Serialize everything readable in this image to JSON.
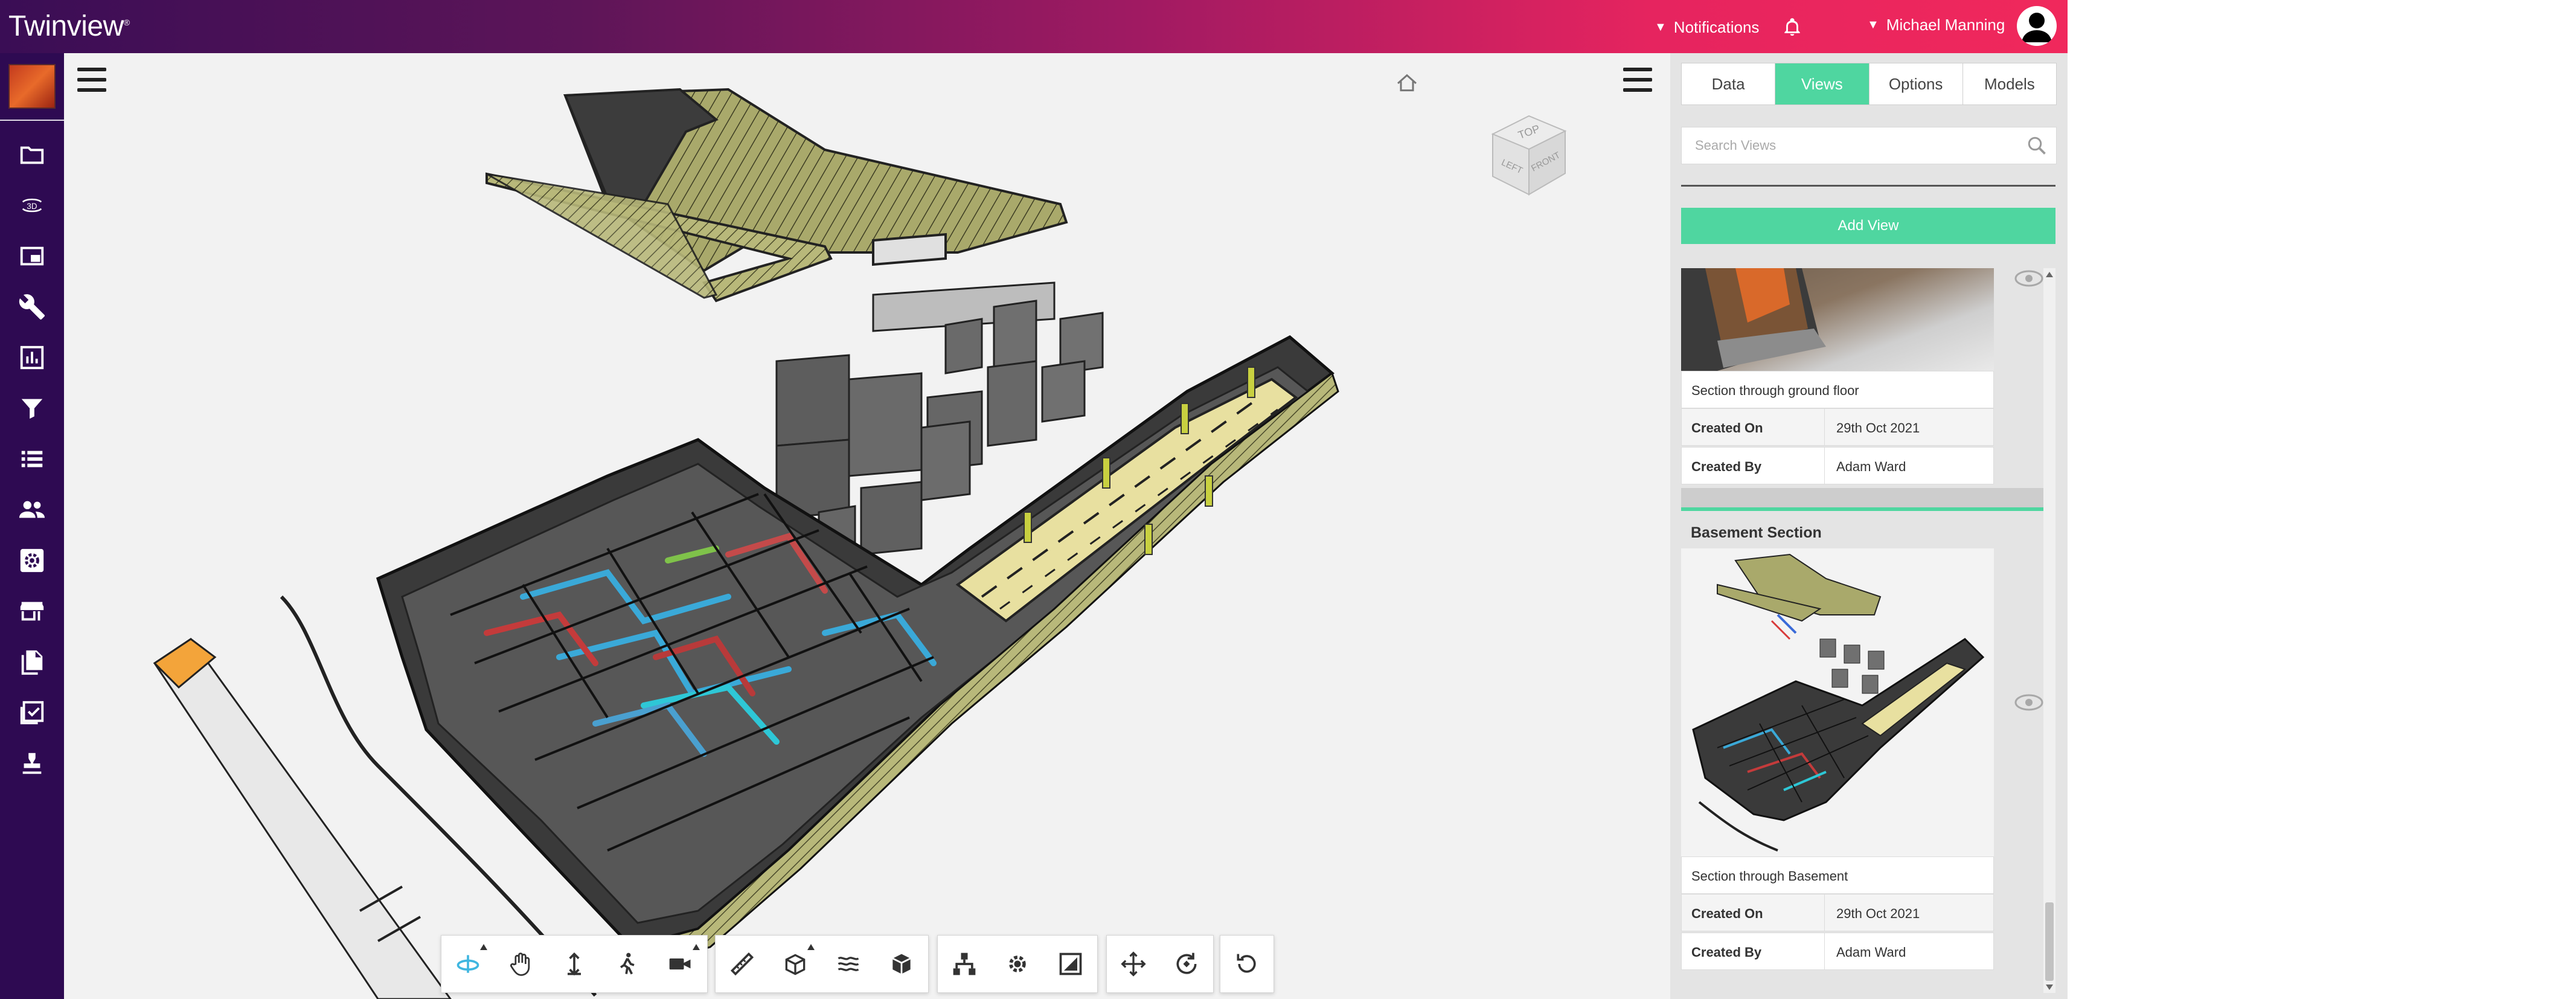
{
  "app": {
    "logo_text": "Twinview",
    "logo_mark": "®",
    "notifications_label": "Notifications",
    "user_name": "Michael Manning"
  },
  "sidebar": {
    "items": [
      {
        "name": "folder-icon"
      },
      {
        "name": "3d-view-icon",
        "label": "3D"
      },
      {
        "name": "picture-in-picture-icon"
      },
      {
        "name": "wrench-icon"
      },
      {
        "name": "bar-chart-icon"
      },
      {
        "name": "filter-icon"
      },
      {
        "name": "list-icon"
      },
      {
        "name": "people-icon"
      },
      {
        "name": "settings-box-icon"
      },
      {
        "name": "store-icon"
      },
      {
        "name": "documents-icon"
      },
      {
        "name": "checklist-icon"
      },
      {
        "name": "stamp-icon"
      }
    ]
  },
  "viewer": {
    "navcube": {
      "top": "TOP",
      "left": "LEFT",
      "front": "FRONT"
    },
    "toolbar_groups": [
      [
        "orbit-icon",
        "pan-icon",
        "dolly-icon",
        "first-person-icon",
        "camera-icon"
      ],
      [
        "measure-icon",
        "section-box-icon",
        "explode-icon",
        "model-browser-icon"
      ],
      [
        "structure-icon",
        "settings-icon",
        "fullscreen-icon"
      ],
      [
        "move-icon",
        "rotate-view-icon"
      ],
      [
        "reset-icon"
      ]
    ]
  },
  "panel": {
    "tabs": [
      "Data",
      "Views",
      "Options",
      "Models"
    ],
    "active_tab": "Views",
    "search_placeholder": "Search Views",
    "add_view_label": "Add View",
    "views": [
      {
        "title": "",
        "description": "Section through ground floor",
        "created_on_label": "Created On",
        "created_on": "29th Oct 2021",
        "created_by_label": "Created By",
        "created_by": "Adam Ward"
      },
      {
        "title": "Basement Section",
        "description": "Section through Basement",
        "created_on_label": "Created On",
        "created_on": "29th Oct 2021",
        "created_by_label": "Created By",
        "created_by": "Adam Ward"
      }
    ]
  },
  "colors": {
    "accent": "#4fd6a0",
    "sidebar": "#2e0a52",
    "topbar_start": "#3a0d55",
    "topbar_end": "#f0285c"
  }
}
